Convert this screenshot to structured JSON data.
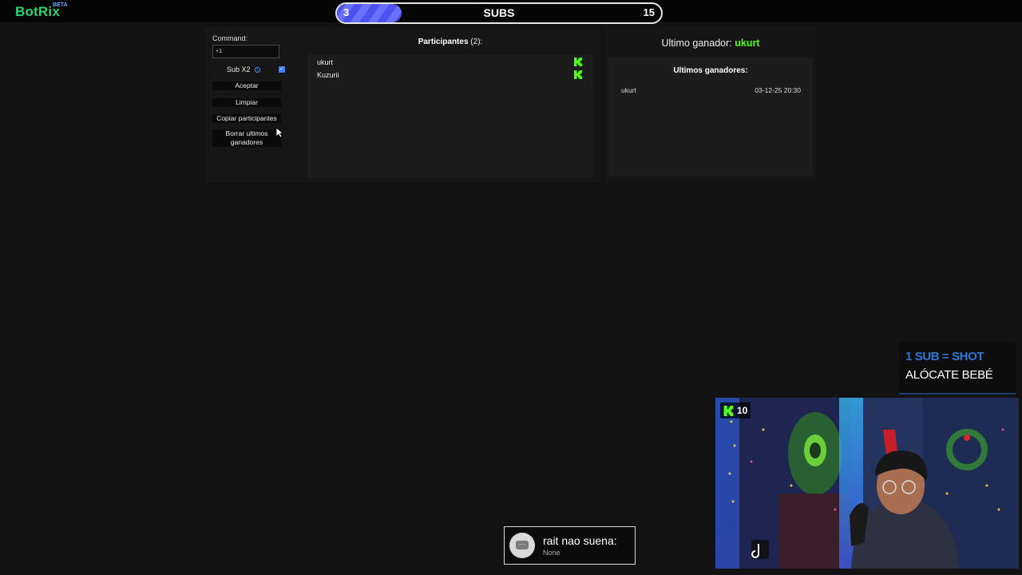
{
  "brand": {
    "name": "BotRix",
    "tag": "BETA"
  },
  "subs_goal": {
    "current": "3",
    "label": "SUBS",
    "goal": "15",
    "progress": 0.2
  },
  "controls": {
    "command_label": "Command:",
    "command_value": "+1",
    "subx2_label": "Sub X2",
    "subx2_checked": true,
    "accept_label": "Aceptar",
    "clear_label": "Limpiar",
    "copy_label": "Copiar participantes",
    "clear_winners_label": "Borrar ultimos ganadores"
  },
  "participants": {
    "title": "Participantes",
    "count": "(2):",
    "list": [
      "ukurt",
      "Kuzurii"
    ]
  },
  "winners": {
    "last_winner_label": "Ultimo ganador:",
    "last_winner_name": "ukurt",
    "history_title": "Ultimos ganadores:",
    "history": [
      {
        "name": "ukurt",
        "date": "03-12-25 20:30"
      }
    ]
  },
  "overlay": {
    "sub_shot": "1 SUB = SHOT",
    "alocate": "ALÓCATE BEBÉ",
    "viewer_count": "10"
  },
  "notification": {
    "title": "rait nao suena:",
    "subtitle": "None"
  },
  "colors": {
    "accent_green": "#53fc18",
    "progress_blue": "#4c52f0",
    "brand_green": "#2fd36b"
  },
  "icons": [
    "info-icon",
    "check-icon",
    "kick-logo-icon",
    "chat-bubble-icon",
    "cursor-icon"
  ]
}
